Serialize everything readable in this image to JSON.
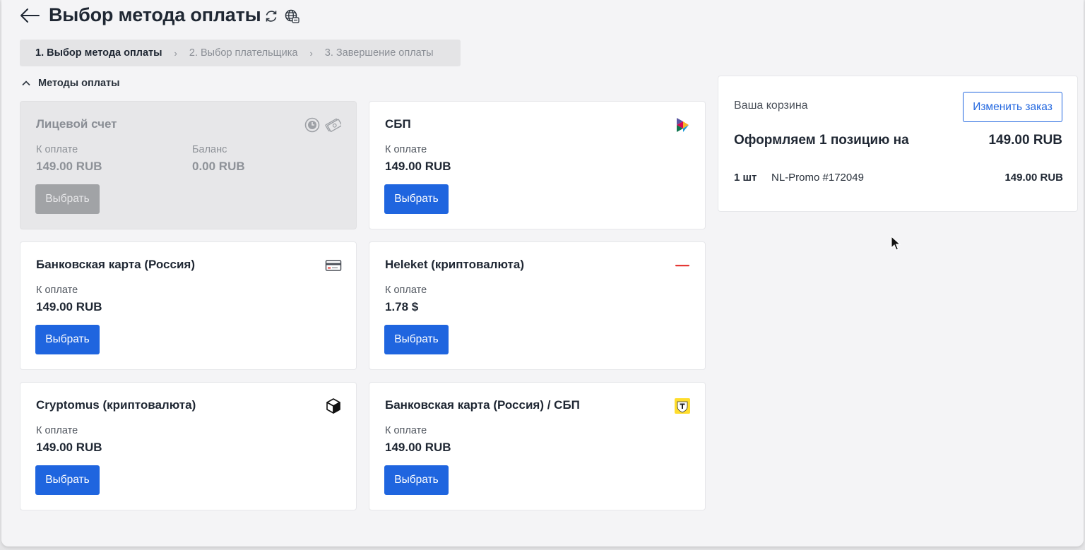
{
  "header": {
    "title": "Выбор метода оплаты"
  },
  "breadcrumb": [
    {
      "label": "1. Выбор метода оплаты",
      "active": true
    },
    {
      "label": "2. Выбор плательщика",
      "active": false
    },
    {
      "label": "3. Завершение оплаты",
      "active": false
    }
  ],
  "section": {
    "label": "Методы оплаты",
    "expanded": true
  },
  "methods": [
    {
      "title": "Лицевой счет",
      "icons": [
        "history-clock-icon",
        "money-bills-icon"
      ],
      "amount_label": "К оплате",
      "amount": "149.00 RUB",
      "balance_label": "Баланс",
      "balance": "0.00 RUB",
      "button": "Выбрать",
      "disabled": true
    },
    {
      "title": "СБП",
      "icon": "sbp-logo-icon",
      "amount_label": "К оплате",
      "amount": "149.00 RUB",
      "button": "Выбрать"
    },
    {
      "title": "Банковская карта (Россия)",
      "icon": "bank-card-icon",
      "amount_label": "К оплате",
      "amount": "149.00 RUB",
      "button": "Выбрать"
    },
    {
      "title": "Heleket (криптовалюта)",
      "icon": "heleket-logo-icon",
      "amount_label": "К оплате",
      "amount": "1.78 $",
      "button": "Выбрать"
    },
    {
      "title": "Cryptomus (криптовалюта)",
      "icon": "cube-icon",
      "amount_label": "К оплате",
      "amount": "149.00 RUB",
      "button": "Выбрать"
    },
    {
      "title": "Банковская карта (Россия) / СБП",
      "icon": "tbank-logo-icon",
      "amount_label": "К оплате",
      "amount": "149.00 RUB",
      "button": "Выбрать"
    }
  ],
  "cart": {
    "title": "Ваша корзина",
    "edit_button": "Изменить заказ",
    "summary": "Оформляем 1 позицию на",
    "total": "149.00 RUB",
    "items": [
      {
        "qty": "1 шт",
        "name": "NL-Promo #172049",
        "price": "149.00 RUB"
      }
    ]
  },
  "colors": {
    "primary": "#1f65df",
    "disabled_button": "#a1a3a6",
    "page_bg": "#f4f4f6",
    "heleket_red": "#e53935",
    "tbank_yellow": "#ffdd2d"
  }
}
